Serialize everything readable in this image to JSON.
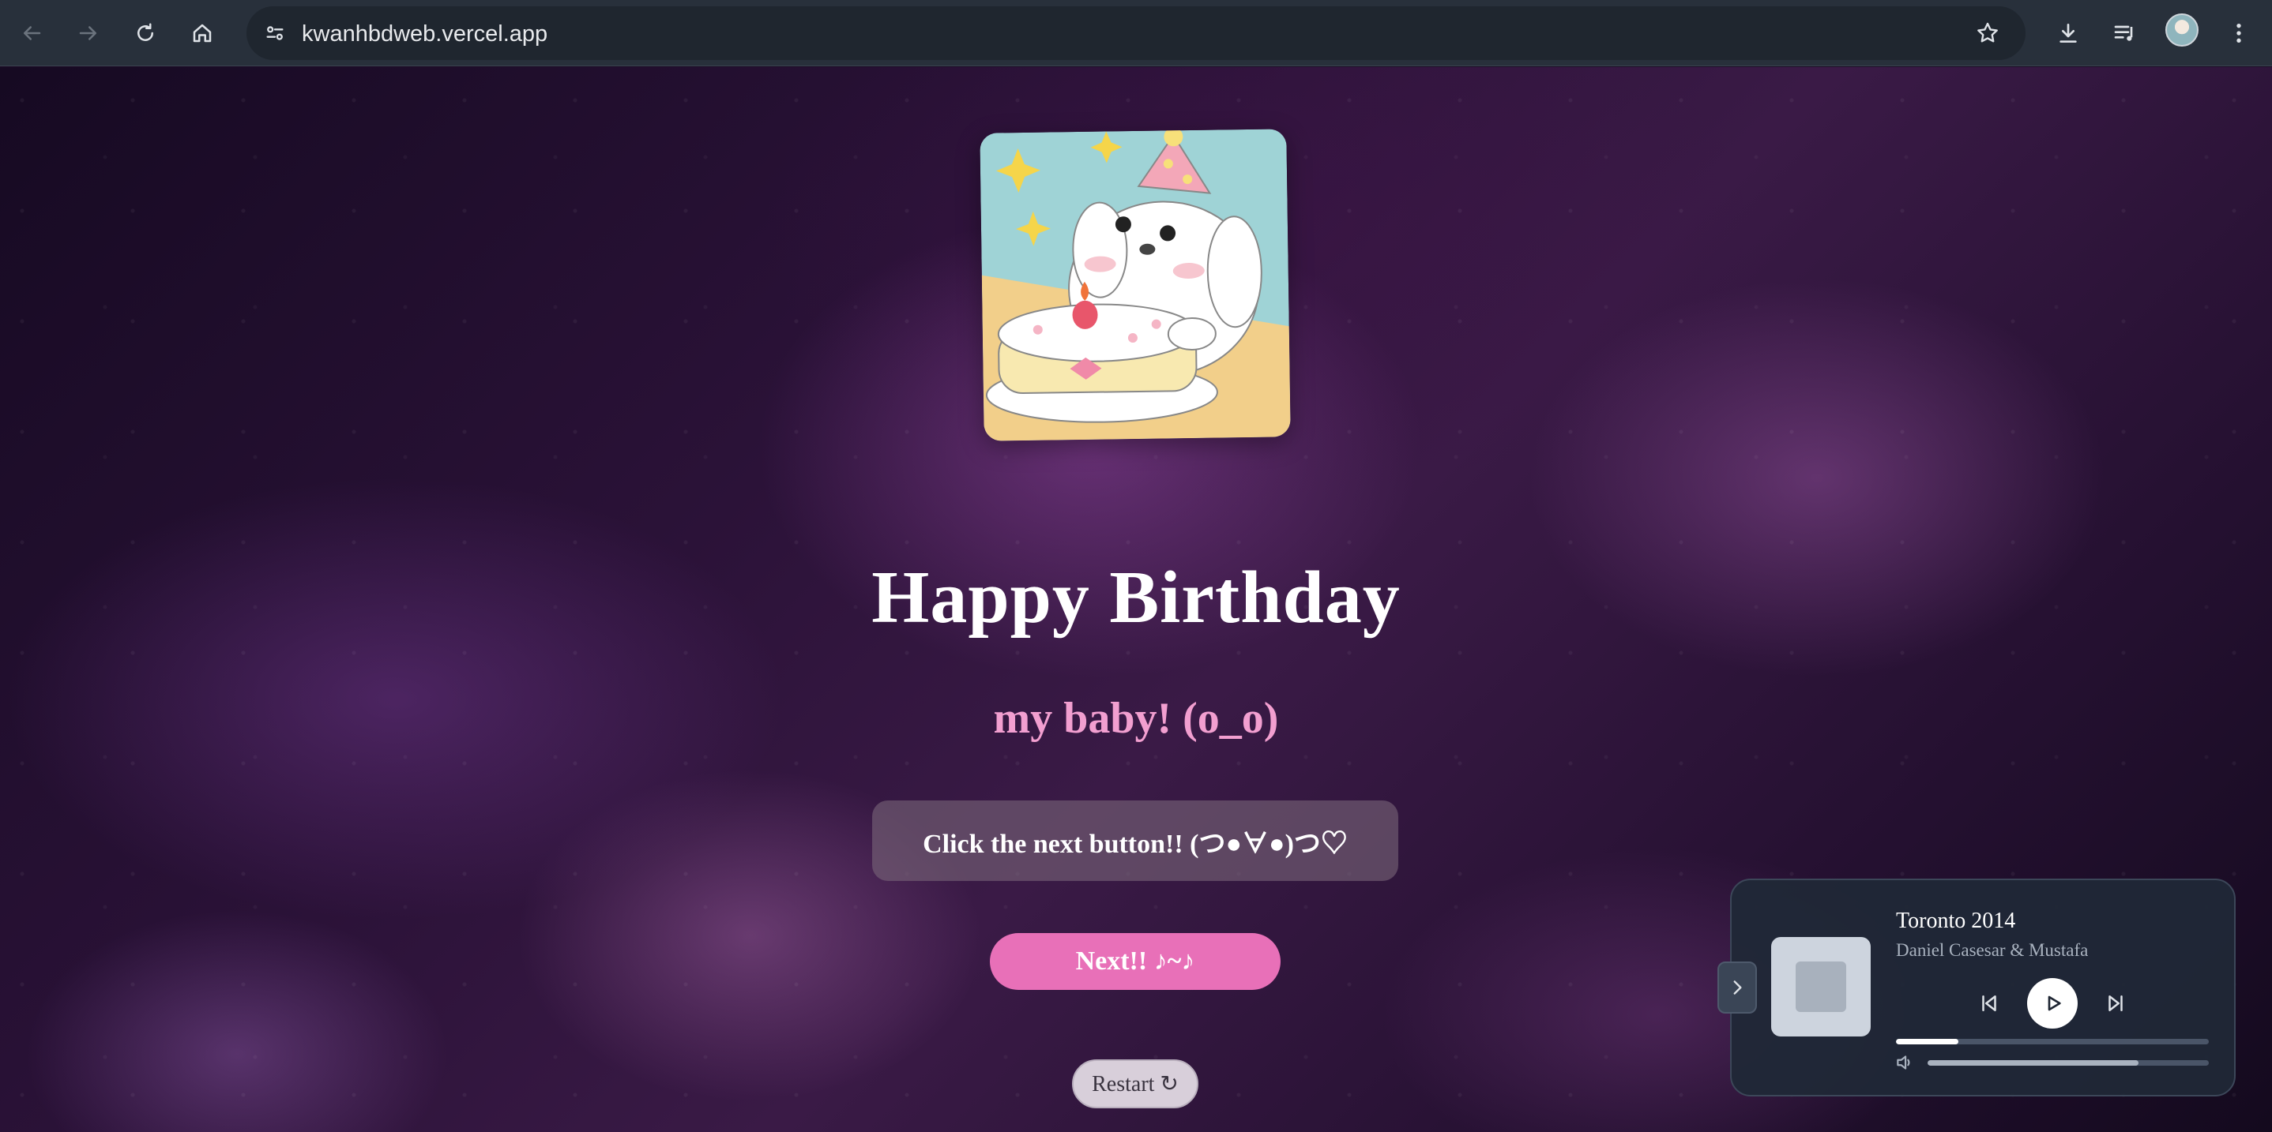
{
  "browser": {
    "url": "kwanhbdweb.vercel.app",
    "icons": {
      "back": "back-arrow-icon",
      "forward": "forward-arrow-icon",
      "reload": "reload-icon",
      "home": "home-icon",
      "site_info": "tune-icon",
      "bookmark": "star-icon",
      "downloads": "download-icon",
      "media": "media-queue-icon",
      "menu": "more-vertical-icon"
    }
  },
  "main": {
    "title": "Happy Birthday",
    "subtitle": "my baby! (o_o)",
    "message": "Click the next button!! (つ●∀●)つ♡",
    "next_label": "Next!! ♪~♪",
    "restart_label": "Restart ↻"
  },
  "player": {
    "song_title": "Toronto 2014",
    "artist": "Daniel Casesar & Mustafa",
    "progress": 0.2,
    "volume": 0.75
  },
  "colors": {
    "accent_pink": "#e870b8",
    "subtitle_pink": "#f29fd0",
    "player_bg": "#202837"
  }
}
